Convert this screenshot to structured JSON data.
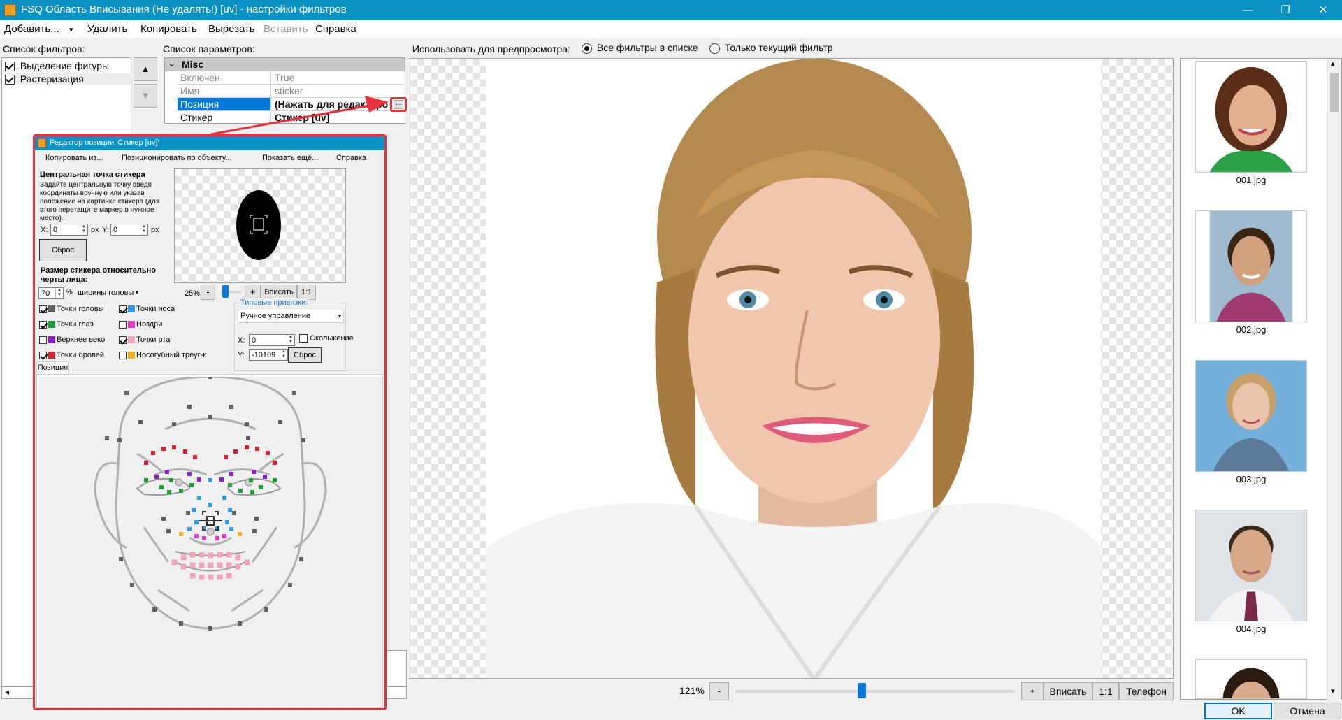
{
  "window": {
    "title": "FSQ Область Вписывания (Не удалять!) [uv] - настройки фильтров",
    "minimize_glyph": "—",
    "maximize_glyph": "❐",
    "close_glyph": "✕"
  },
  "menu": {
    "add": "Добавить...",
    "add_arrow": "▾",
    "delete": "Удалить",
    "copy": "Копировать",
    "cut": "Вырезать",
    "paste": "Вставить",
    "help": "Справка"
  },
  "filters": {
    "label": "Список фильтров:",
    "items": [
      {
        "label": "Выделение фигуры",
        "checked": true
      },
      {
        "label": "Растеризация",
        "checked": true
      }
    ],
    "up_glyph": "▲",
    "down_glyph": "▼"
  },
  "params": {
    "label": "Список параметров:",
    "group": "Misc",
    "group_glyph": "⌄",
    "rows": [
      {
        "key": "Включен",
        "value": "True"
      },
      {
        "key": "Имя",
        "value": "sticker"
      },
      {
        "key": "Позиция",
        "value": "(Нажать для редактирования)"
      },
      {
        "key": "Стикер",
        "value": "Стикер [uv]"
      }
    ],
    "ellipsis": "..."
  },
  "preview": {
    "label": "Использовать для предпросмотра:",
    "options": [
      {
        "label": "Все фильтры в списке",
        "selected": true
      },
      {
        "label": "Только текущий фильтр",
        "selected": false
      }
    ],
    "zoom": "121%",
    "zoom_level": 0.45,
    "minus": "-",
    "plus": "+",
    "fit": "Вписать",
    "one_to_one": "1:1",
    "phone": "Телефон"
  },
  "thumbnails": [
    {
      "caption": "001.jpg"
    },
    {
      "caption": "002.jpg"
    },
    {
      "caption": "003.jpg"
    },
    {
      "caption": "004.jpg"
    }
  ],
  "footer": {
    "ok": "OK",
    "cancel": "Отмена"
  },
  "dialog": {
    "title": "Редактор позиции 'Стикер [uv]'",
    "menu": {
      "copy_from": "Копировать из...",
      "position_by": "Позиционировать по объекту...",
      "show_more": "Показать ещё...",
      "help": "Справка"
    },
    "center": {
      "heading": "Центральная точка стикера",
      "desc": "Задайте центральную точку введя координаты вручную или указав положение на картинке стикера (для этого перетащите маркер в нужное место).",
      "x_label": "X:",
      "x_value": "0",
      "y_label": "Y:",
      "y_value": "0",
      "unit": "px",
      "reset": "Сброс"
    },
    "size": {
      "heading": "Размер стикера относительно черты лица:",
      "value": "70",
      "unit": "%",
      "ref": "ширины головы",
      "zoom": "25%",
      "zoom_level": 0.1,
      "minus": "-",
      "plus": "+",
      "fit": "Вписать",
      "one_to_one": "1:1"
    },
    "legend": [
      {
        "label": "Точки головы",
        "color": "#606060",
        "checked": true
      },
      {
        "label": "Точки носа",
        "color": "#2e9be8",
        "checked": true
      },
      {
        "label": "Точки глаз",
        "color": "#18a030",
        "checked": true
      },
      {
        "label": "Ноздри",
        "color": "#e838c8",
        "checked": false
      },
      {
        "label": "Верхнее веко",
        "color": "#8a1ec8",
        "checked": false
      },
      {
        "label": "Точки рта",
        "color": "#f2a8b8",
        "checked": true
      },
      {
        "label": "Точки бровей",
        "color": "#d82030",
        "checked": true
      },
      {
        "label": "Носогубный треуг-к",
        "color": "#f0b020",
        "checked": false
      }
    ],
    "anchors": {
      "label": "Типовые привязки:",
      "value": "Ручное управление",
      "x_label": "X:",
      "x_value": "0",
      "y_label": "Y:",
      "y_value": "-10109",
      "sliding": "Скольжение",
      "reset": "Сброс"
    },
    "position_tab": "Позиция"
  }
}
